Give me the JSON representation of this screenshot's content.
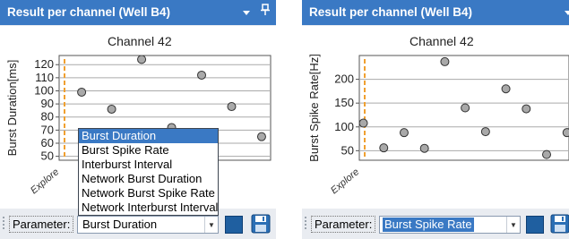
{
  "left_panel": {
    "title": "Result per channel (Well B4)",
    "chart_title": "Channel 42",
    "ylabel": "Burst Duration[ms]",
    "explore_label": "Explore",
    "parameter_label": "Parameter:",
    "parameter_value": "Burst Duration",
    "dropdown_options": [
      "Burst Duration",
      "Burst Spike Rate",
      "Interburst Interval",
      "Network Burst Duration",
      "Network Burst Spike Rate",
      "Network Interburst Interval"
    ]
  },
  "right_panel": {
    "title": "Result per channel (Well B4)",
    "chart_title": "Channel 42",
    "ylabel": "Burst Spike Rate[Hz]",
    "explore_label": "Explore",
    "parameter_label": "Parameter:",
    "parameter_value": "Burst Spike Rate"
  },
  "colors": {
    "titlebar": "#3a79c4",
    "explore_line": "#f0a030",
    "marker_fill": "#a9a9a9",
    "selection": "#3a79c4"
  },
  "icons": [
    "dropdown-arrow-icon",
    "pin-icon",
    "save-icon"
  ],
  "chart_data": [
    {
      "type": "scatter",
      "title": "Channel 42",
      "ylabel": "Burst Duration[ms]",
      "yticks": [
        50,
        60,
        70,
        80,
        90,
        100,
        110,
        120
      ],
      "ylim": [
        47,
        127
      ],
      "grid": true,
      "x": [
        1,
        2,
        3,
        4,
        5,
        6,
        7
      ],
      "values": [
        99,
        86,
        124,
        72,
        112,
        88,
        65
      ],
      "x_visible_range": [
        0.25,
        7.3
      ]
    },
    {
      "type": "scatter",
      "title": "Channel 42",
      "ylabel": "Burst Spike Rate[Hz]",
      "yticks": [
        50,
        100,
        150,
        200
      ],
      "ylim": [
        30,
        250
      ],
      "grid": true,
      "x": [
        1,
        2,
        3,
        4,
        5,
        6,
        7,
        8,
        9,
        10,
        11
      ],
      "values": [
        108,
        56,
        88,
        55,
        237,
        140,
        90,
        180,
        138,
        42,
        88
      ],
      "x_visible_range": [
        0.8,
        11.1
      ]
    }
  ]
}
